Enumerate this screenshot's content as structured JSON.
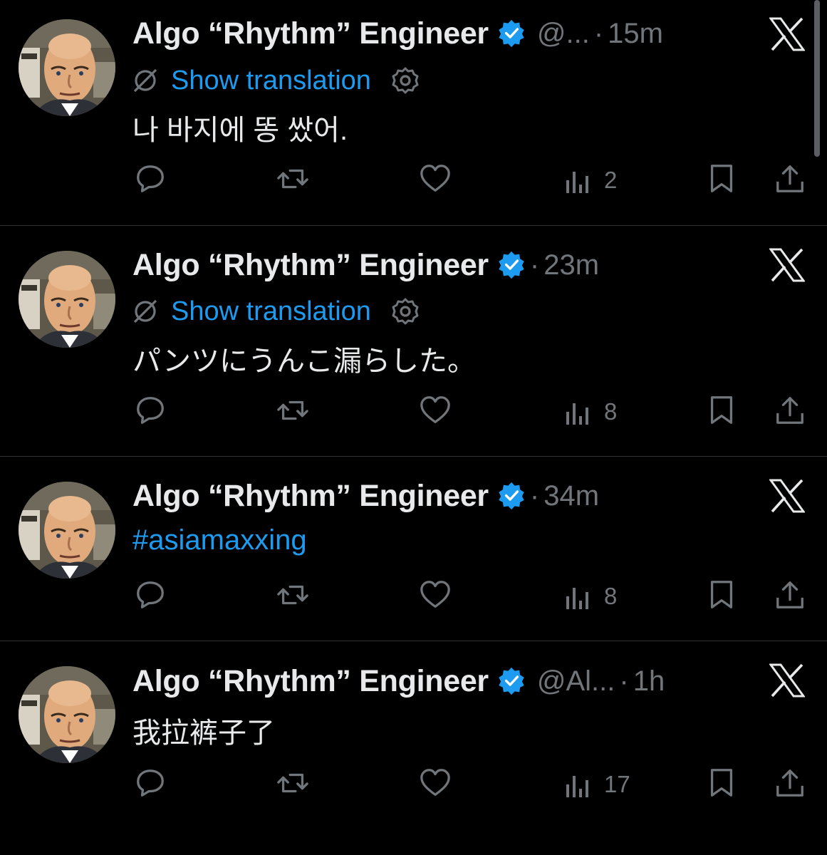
{
  "author": {
    "display_name": "Algo “Rhythm” Engineer",
    "handle_truncated_short": "@...",
    "handle_truncated_long": "@Al..."
  },
  "translation": {
    "link_label": "Show translation"
  },
  "tweets": [
    {
      "handle": "@...",
      "time": "15m",
      "show_translation": true,
      "text": "나 바지에 똥 쌌어.",
      "views": "2"
    },
    {
      "handle": "",
      "time": "23m",
      "show_translation": true,
      "text": "パンツにうんこ漏らした。",
      "views": "8"
    },
    {
      "handle": "",
      "time": "34m",
      "show_translation": false,
      "text": "#asiamaxxing",
      "views": "8"
    },
    {
      "handle": "@Al...",
      "time": "1h",
      "show_translation": false,
      "text": "我拉裤子了",
      "views": "17"
    }
  ],
  "icons": [
    "verified-badge-icon",
    "x-logo-icon",
    "translate-globe-icon",
    "settings-gear-icon",
    "reply-icon",
    "retweet-icon",
    "like-icon",
    "views-icon",
    "bookmark-icon",
    "share-icon"
  ],
  "colors": {
    "background": "#000000",
    "link": "#1d9bf0",
    "verified": "#1d9bf0",
    "muted": "#71767b",
    "text": "#e7e9ea"
  }
}
